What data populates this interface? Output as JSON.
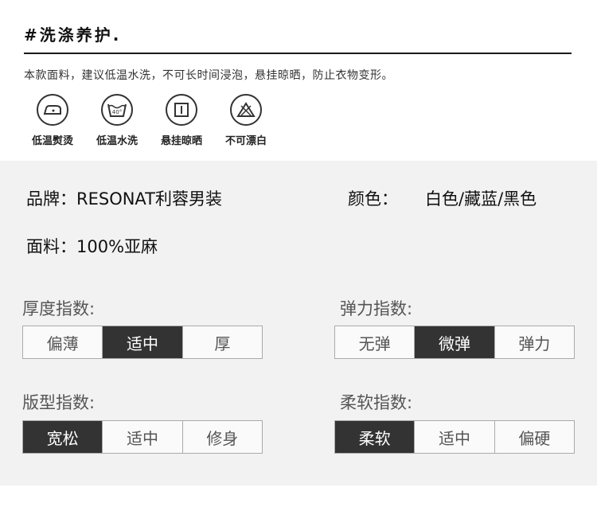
{
  "care": {
    "title": "#洗涤养护.",
    "description": "本款面料，建议低温水洗，不可长时间浸泡，悬挂晾晒，防止衣物变形。",
    "icons": [
      {
        "icon": "iron-low-heat-icon",
        "label": "低温熨烫"
      },
      {
        "icon": "wash-40-icon",
        "label": "低温水洗"
      },
      {
        "icon": "hang-dry-icon",
        "label": "悬挂晾晒"
      },
      {
        "icon": "no-bleach-icon",
        "label": "不可漂白"
      },
      {
        "wash_temp": "40°"
      }
    ]
  },
  "specs": {
    "brand_label": "品牌：",
    "brand_value": "RESONAT利蓉男装",
    "color_label": "颜色：",
    "color_value": "白色/藏蓝/黑色",
    "fabric_label": "面料：",
    "fabric_value": "100%亚麻"
  },
  "indices": {
    "thickness": {
      "title": "厚度指数:",
      "options": [
        "偏薄",
        "适中",
        "厚"
      ],
      "selected": "适中"
    },
    "elasticity": {
      "title": "弹力指数:",
      "options": [
        "无弹",
        "微弹",
        "弹力"
      ],
      "selected": "微弹"
    },
    "fit": {
      "title": "版型指数:",
      "options": [
        "宽松",
        "适中",
        "修身"
      ],
      "selected": "宽松"
    },
    "softness": {
      "title": "柔软指数:",
      "options": [
        "柔软",
        "适中",
        "偏硬"
      ],
      "selected": "柔软"
    }
  },
  "colors": {
    "active": "#333333",
    "inactive_text": "#555555",
    "panel_bg": "#f2f2f2"
  }
}
